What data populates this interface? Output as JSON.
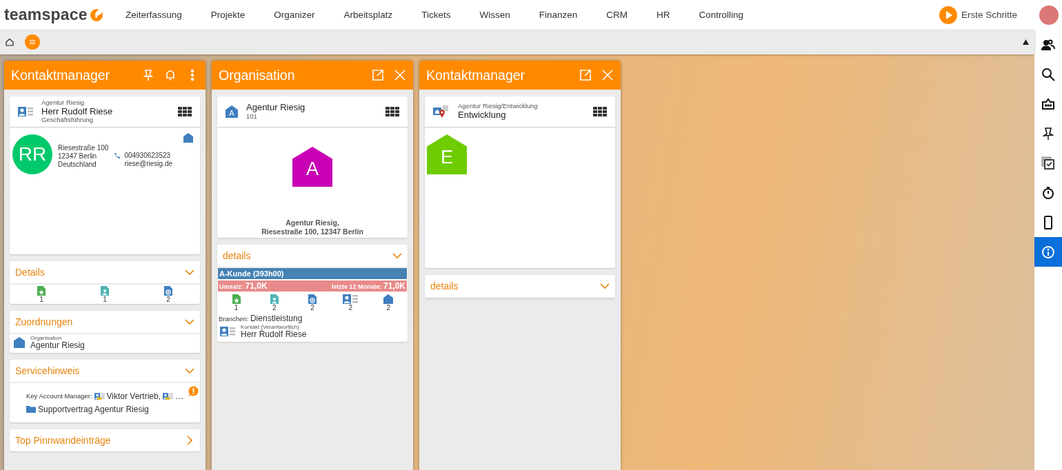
{
  "topbar": {
    "logo": "teamspace",
    "nav": [
      "Zeiterfassung",
      "Projekte",
      "Organizer",
      "Arbeitsplatz",
      "Tickets",
      "Wissen",
      "Finanzen",
      "CRM",
      "HR",
      "Controlling"
    ],
    "getting_started": "Erste Schritte"
  },
  "sidebar": {
    "items": [
      {
        "kind": "people",
        "selected": false
      },
      {
        "kind": "search",
        "selected": false
      },
      {
        "kind": "inbox",
        "selected": false
      },
      {
        "kind": "pin",
        "selected": false
      },
      {
        "kind": "tasks",
        "selected": false
      },
      {
        "kind": "timer",
        "selected": false
      },
      {
        "kind": "phone",
        "selected": false
      },
      {
        "kind": "info",
        "selected": true
      }
    ]
  },
  "panels": [
    {
      "title": "Kontaktmanager",
      "kind": "main",
      "record": {
        "kind": "person",
        "context": "Agentur Riesig",
        "title": "Herr Rudolf Riese",
        "subtitle": "Geschäftsführung",
        "initials": "RR",
        "color": "#00c96b",
        "address": [
          "Riesestraße 100",
          "12347 Berlin",
          "Deutschland"
        ],
        "phone": "004930623523",
        "email": "riese@riesig.de"
      },
      "sections": [
        {
          "kind": "counts",
          "title": "Details",
          "expanded": true,
          "counts": [
            {
              "kind": "star",
              "value": "1"
            },
            {
              "kind": "person",
              "value": "1"
            },
            {
              "kind": "gear",
              "value": "2"
            }
          ]
        },
        {
          "kind": "assignment",
          "title": "Zuordnungen",
          "expanded": true,
          "label": "Organisation",
          "value": "Agentur Riesig"
        },
        {
          "kind": "service",
          "title": "Servicehinweis",
          "expanded": true,
          "manager_label": "Key Account Manager:",
          "managers": [
            "Viktor Vertrieb,",
            "…"
          ],
          "contract": "Supportvertrag Agentur Riesig"
        },
        {
          "kind": "link",
          "title": "Top Pinnwandeinträge",
          "expanded": false
        }
      ]
    },
    {
      "title": "Organisation",
      "kind": "window",
      "record": {
        "kind": "organisation",
        "title": "Agentur Riesig",
        "subtitle": "101",
        "icon_initial": "A",
        "initial": "A",
        "color": "#c800b4",
        "caption": [
          "Agentur Riesig,",
          "Riesestraße 100, 12347 Berlin"
        ]
      },
      "sections": [
        {
          "kind": "org_details",
          "title": "details",
          "expanded": true,
          "category": "A-Kunde (393h00)",
          "revenue_label": "Umsatz:",
          "revenue": "71,0K",
          "period_label": "letzte 12 Monate:",
          "period_revenue": "71,0K",
          "counts": [
            {
              "kind": "star",
              "value": "1"
            },
            {
              "kind": "person",
              "value": "2"
            },
            {
              "kind": "gear",
              "value": "2"
            },
            {
              "kind": "card",
              "value": "2"
            },
            {
              "kind": "house",
              "value": "2"
            }
          ],
          "industry_label": "Branchen:",
          "industry": "Dienstleistung",
          "contact_label": "Kontakt (Verantwortlich)",
          "contact": "Herr Rudolf Riese"
        }
      ]
    },
    {
      "title": "Kontaktmanager",
      "kind": "window",
      "record": {
        "kind": "department",
        "context": "Agentur Riesig/Entwicklung",
        "title": "Entwicklung",
        "initial": "E",
        "color": "#6fcc00"
      },
      "sections": [
        {
          "kind": "empty",
          "title": "details",
          "expanded": true
        }
      ]
    }
  ]
}
